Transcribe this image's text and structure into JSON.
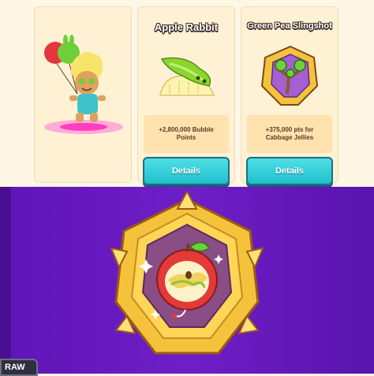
{
  "cards": [
    {
      "name": "cookie-card",
      "title": "",
      "description": "",
      "button": ""
    },
    {
      "name": "apple-rabbit-card",
      "title": "Apple Rabbit",
      "description": "+2,800,000 Bubble Points",
      "button": "Details"
    },
    {
      "name": "green-pea-slingshot-card",
      "title": "Green Pea Slingshot",
      "description": "+375,000 pts for Cabbage Jellies",
      "button": "Details"
    }
  ],
  "bottom_panel": {
    "corner_tab_label": "RAW",
    "featured_item_icon": "apple-treasure-medal-icon"
  },
  "icons": {
    "card1": "apple-cookie-character-icon",
    "card2": "apple-rabbit-pet-icon",
    "card3": "green-pea-slingshot-treasure-icon"
  },
  "colors": {
    "card_bg": "#fff1d4",
    "button": "#2bcad6",
    "bottom_bg": "#6a1cc2",
    "gold": "#f4c33b"
  }
}
